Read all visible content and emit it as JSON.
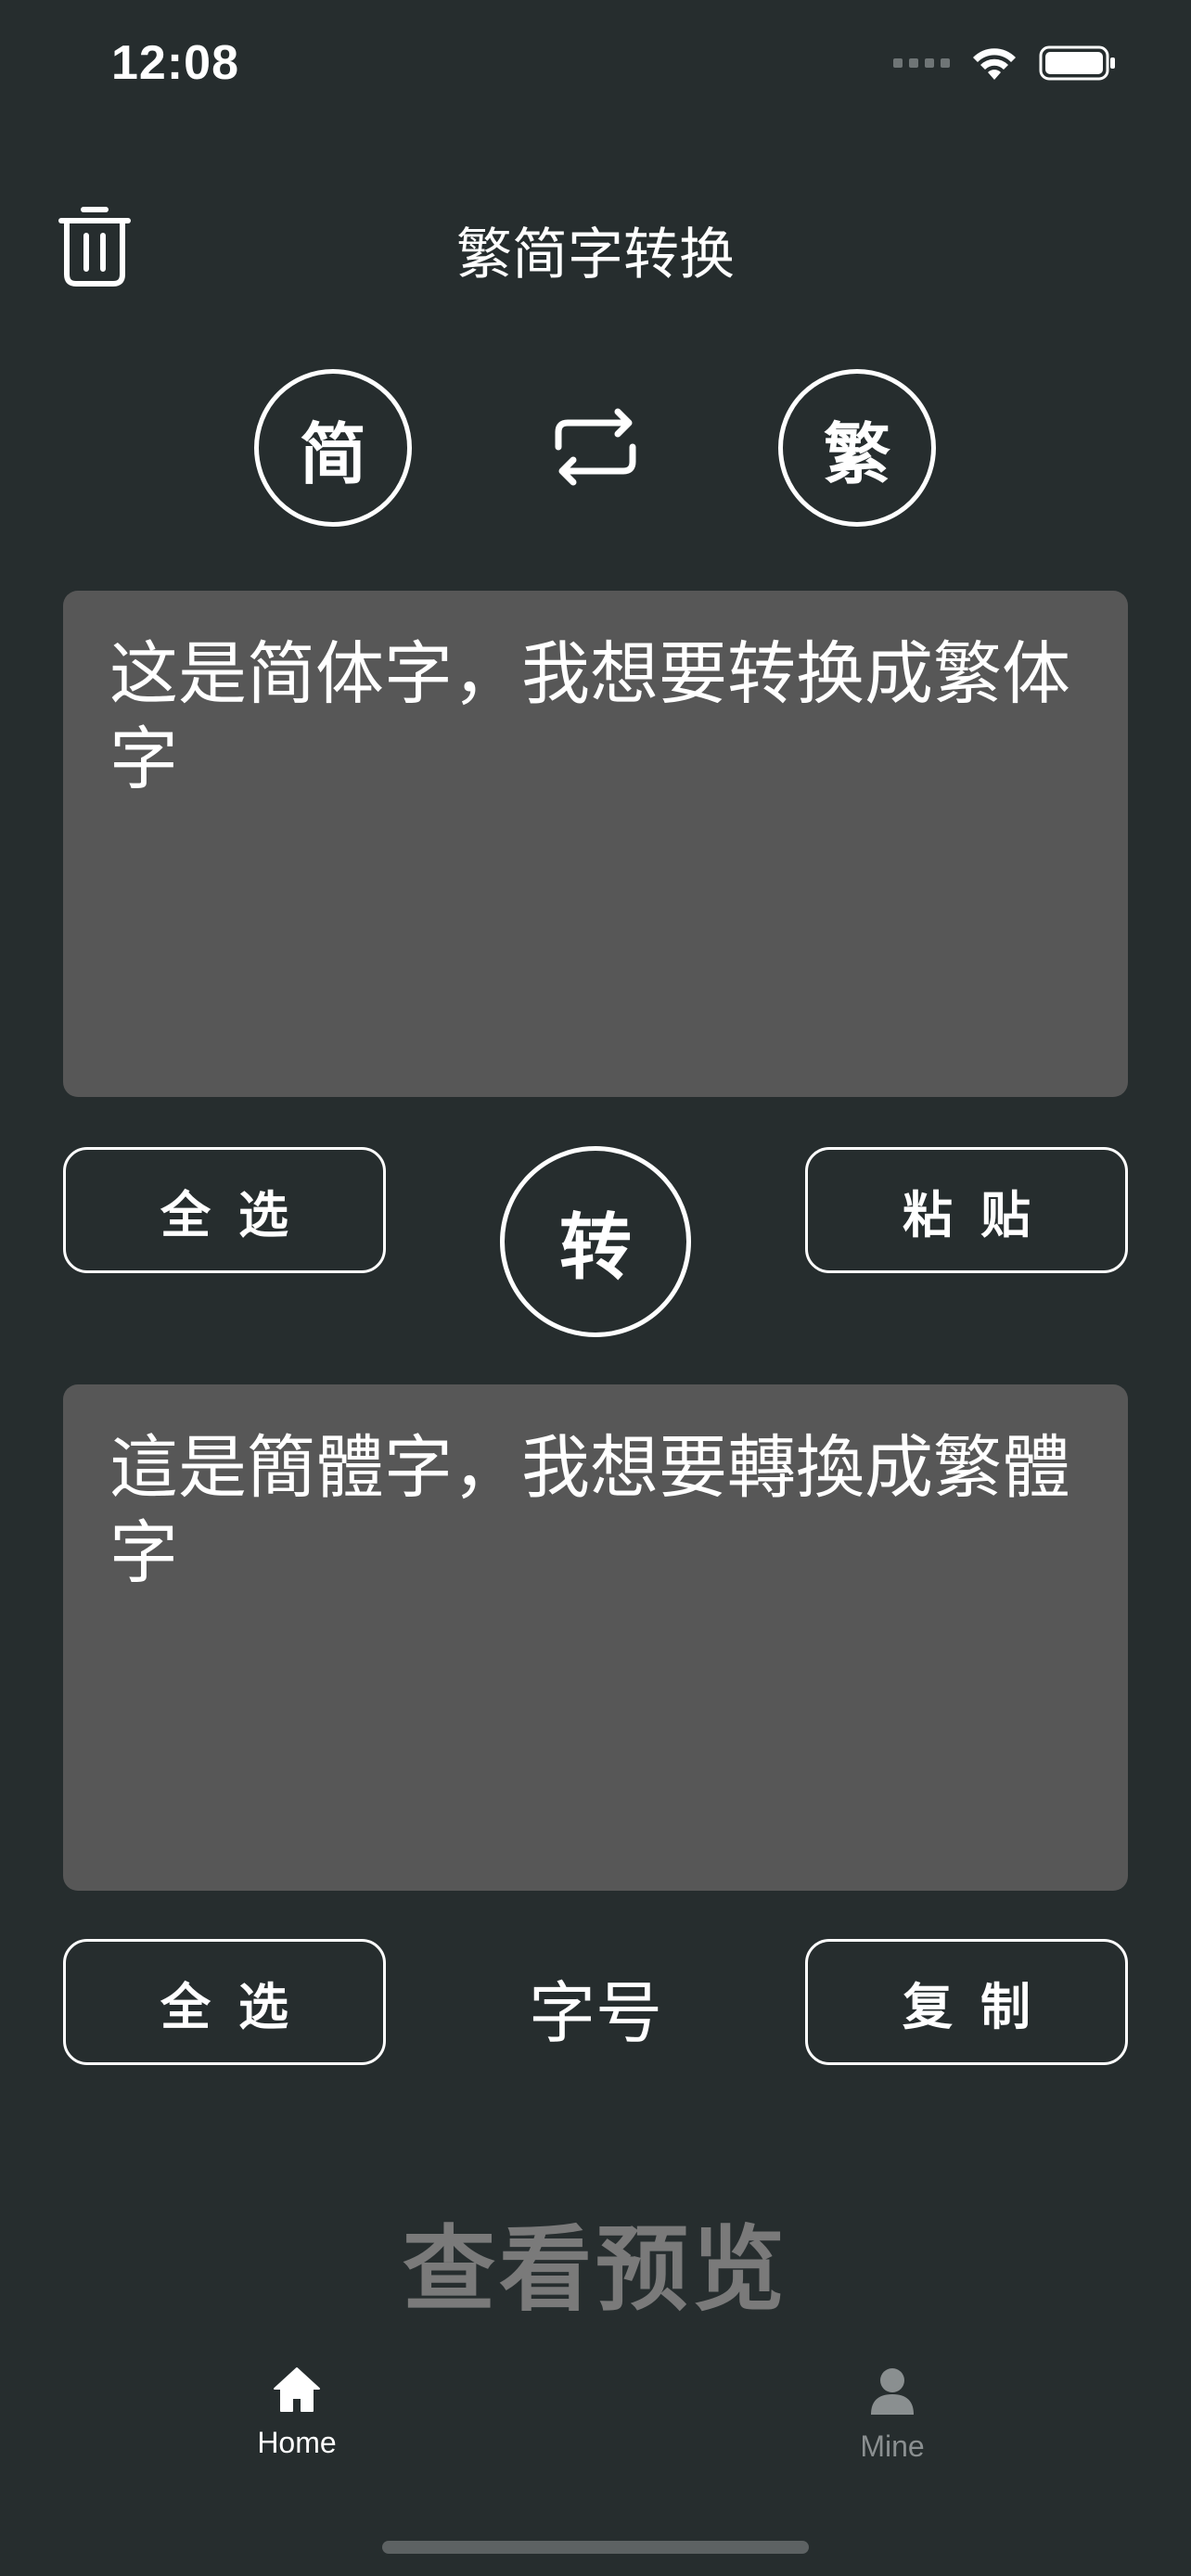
{
  "status_bar": {
    "time": "12:08",
    "signal_icon": "signal-dots-icon",
    "wifi_icon": "wifi-icon",
    "battery_icon": "battery-icon"
  },
  "header": {
    "title": "繁简字转换",
    "clear_icon": "trash-icon"
  },
  "direction": {
    "source": "简",
    "target": "繁",
    "swap_icon": "swap-arrows-icon"
  },
  "input_panel": {
    "text": "这是简体字，我想要转换成繁体字"
  },
  "input_actions": {
    "select_all": "全选",
    "convert": "转",
    "paste": "粘贴"
  },
  "output_panel": {
    "text": "這是簡體字，我想要轉換成繁體字"
  },
  "output_actions": {
    "select_all": "全选",
    "font_size": "字号",
    "copy": "复制"
  },
  "preview": {
    "label": "查看预览"
  },
  "tab_bar": {
    "tabs": [
      {
        "label": "Home",
        "icon": "home-icon",
        "active": true
      },
      {
        "label": "Mine",
        "icon": "user-icon",
        "active": false
      }
    ]
  },
  "colors": {
    "background": "#262d2e",
    "panel": "#575757",
    "preview_text": "#7a7a7a",
    "inactive_tab": "#8a8f90"
  }
}
